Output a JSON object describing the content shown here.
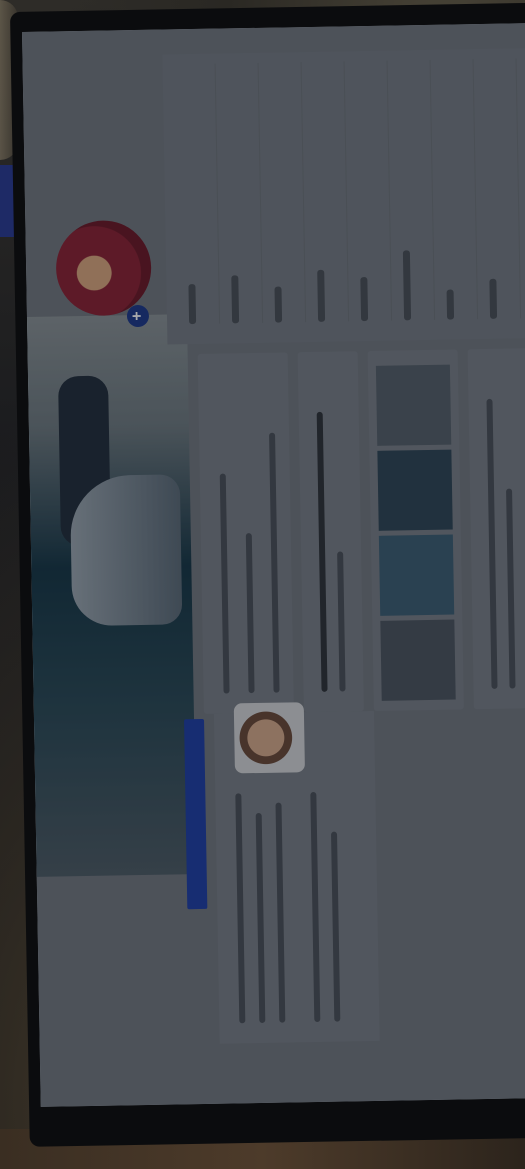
{
  "scene": {
    "description_tag": "photo-of-monitor",
    "colors": {
      "accent_blue": "#223c8c",
      "screen_tone": "#727880",
      "backdrop": "#1b1d20"
    }
  }
}
